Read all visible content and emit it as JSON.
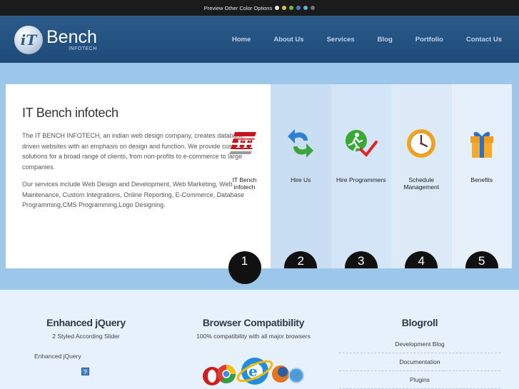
{
  "topbar": {
    "label": "Preview Other Color Options",
    "colors": [
      "#e8e8e8",
      "#d9c43a",
      "#7fb04a",
      "#4a7fc4",
      "#5ab0e0",
      "#777777"
    ]
  },
  "logo": {
    "brand": "Bench",
    "sub": "INFOTECH",
    "mark": "iT"
  },
  "nav": [
    "Home",
    "About Us",
    "Services",
    "Blog",
    "Portfolio",
    "Contact Us"
  ],
  "intro": {
    "title": "IT Bench infotech",
    "p1": "The IT BENCH INFOTECH, an indian web design company, creates database-driven websites with an emphasis on design and function. We provide custom solutions for a broad range of clients, from non-profits to e-commerce to large companies.",
    "p2": "Our services include Web Design and Development, Web Marketing, Web Maintenance, Custom Integrations, Online Reporting, E-Commerce, Database Programming,CMS Programming,Logo Designing."
  },
  "features": [
    {
      "label": "IT Bench infotech",
      "number": "1",
      "icon": "itb-logo-icon"
    },
    {
      "label": "Hire Us",
      "number": "2",
      "icon": "refresh-arrows-icon"
    },
    {
      "label": "Hire Programmers",
      "number": "3",
      "icon": "runner-check-icon"
    },
    {
      "label": "Schedule Management",
      "number": "4",
      "icon": "clock-icon"
    },
    {
      "label": "Benefits",
      "number": "5",
      "icon": "gift-icon"
    }
  ],
  "bottom": {
    "jquery": {
      "title": "Enhanced jQuery",
      "sub": "2 Styled According Slider",
      "item": "Enhanced jQuery",
      "help": "?"
    },
    "browser": {
      "title": "Browser Compatibility",
      "sub": "100% compatibility with all major browsers"
    },
    "blogroll": {
      "title": "Blogroll",
      "items": [
        "Development Blog",
        "Documentation",
        "Plugins"
      ]
    }
  }
}
